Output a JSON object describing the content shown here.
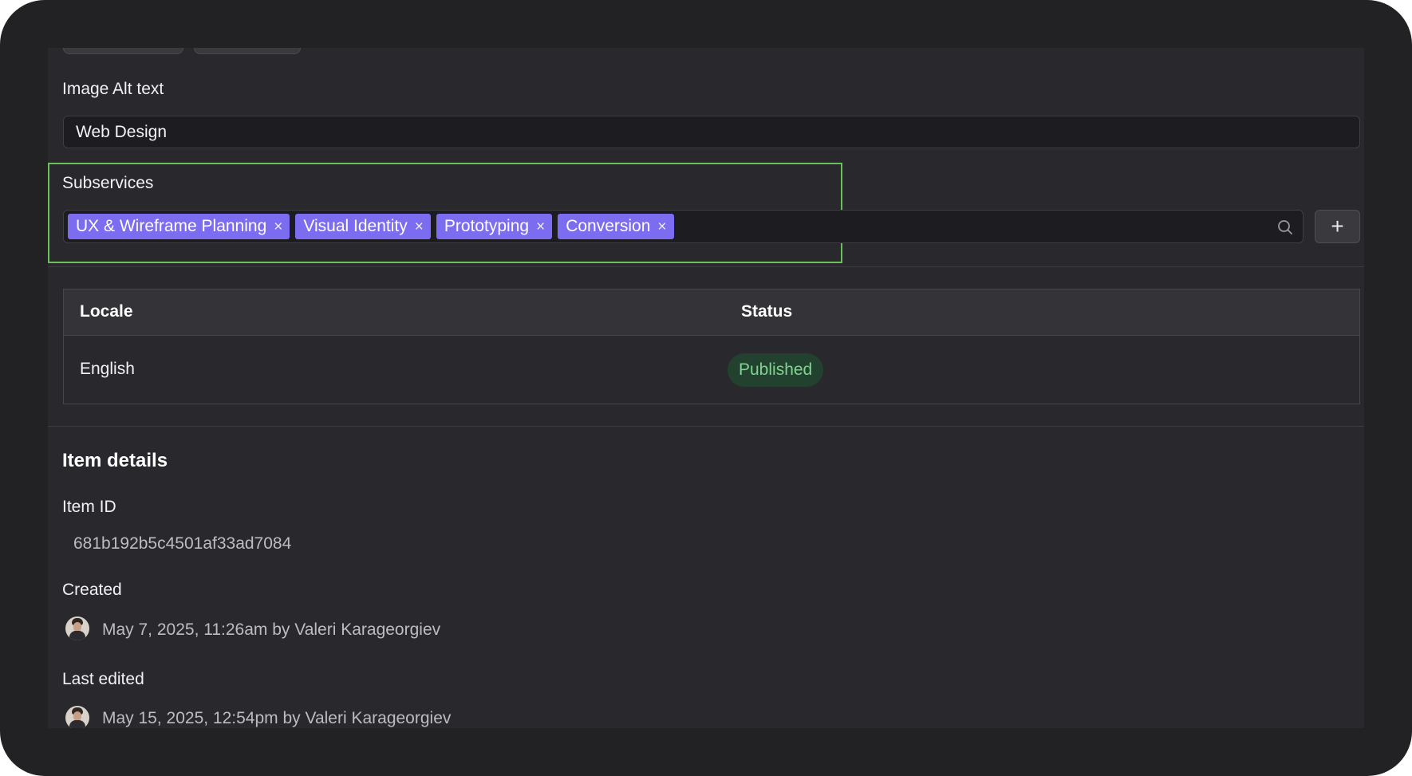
{
  "fields": {
    "image_alt": {
      "label": "Image Alt text",
      "value": "Web Design"
    },
    "subservices": {
      "label": "Subservices",
      "tags": [
        "UX & Wireframe Planning",
        "Visual Identity",
        "Prototyping",
        "Conversion"
      ],
      "remove_glyph": "×",
      "search_icon": "search-icon",
      "add_label": "+"
    }
  },
  "locale_table": {
    "headers": {
      "locale": "Locale",
      "status": "Status"
    },
    "rows": [
      {
        "locale": "English",
        "status": "Published"
      }
    ],
    "status_color": "#7fd48f"
  },
  "item_details": {
    "title": "Item details",
    "item_id": {
      "label": "Item ID",
      "value": "681b192b5c4501af33ad7084"
    },
    "created": {
      "label": "Created",
      "value": "May 7, 2025, 11:26am by Valeri Karageorgiev"
    },
    "last_edited": {
      "label": "Last edited",
      "value": "May 15, 2025, 12:54pm by Valeri Karageorgiev"
    }
  },
  "colors": {
    "tag_bg": "#7b6cf0",
    "focus_outline": "#6bc05c",
    "panel_bg": "#29282d"
  }
}
